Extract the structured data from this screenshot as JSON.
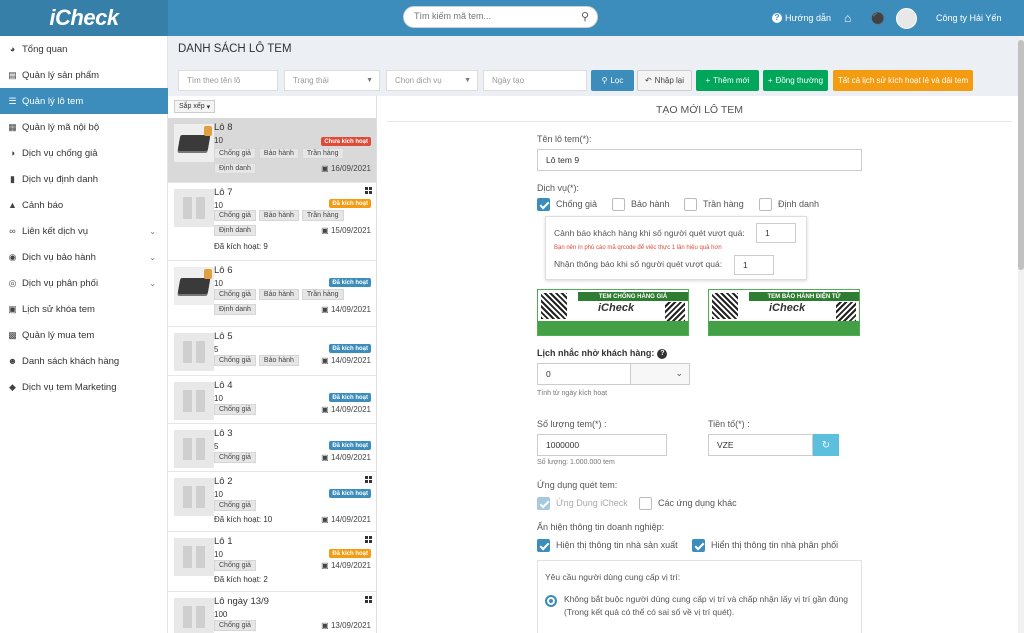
{
  "header": {
    "logo": "iCheck",
    "search_placeholder": "Tìm kiếm mã tem...",
    "guide_label": "Hướng dẫn",
    "company": "Công ty Hải Yến"
  },
  "sidebar": {
    "items": [
      {
        "label": "Tổng quan",
        "icon": "dashboard-icon"
      },
      {
        "label": "Quản lý sản phẩm",
        "icon": "product-icon"
      },
      {
        "label": "Quản lý lô tem",
        "icon": "list-icon"
      },
      {
        "label": "Quản lý mã nội bộ",
        "icon": "book-icon"
      },
      {
        "label": "Dịch vụ chống giả",
        "icon": "shield-icon"
      },
      {
        "label": "Dịch vụ định danh",
        "icon": "id-icon"
      },
      {
        "label": "Cảnh báo",
        "icon": "bell-icon"
      },
      {
        "label": "Liên kết dịch vụ",
        "icon": "link-icon"
      },
      {
        "label": "Dịch vụ bảo hành",
        "icon": "lifebuoy-icon"
      },
      {
        "label": "Dịch vụ phân phối",
        "icon": "globe-icon"
      },
      {
        "label": "Lịch sử khóa tem",
        "icon": "lock-icon"
      },
      {
        "label": "Quản lý mua tem",
        "icon": "cart-icon"
      },
      {
        "label": "Danh sách khách hàng",
        "icon": "users-icon"
      },
      {
        "label": "Dịch vụ tem Marketing",
        "icon": "tag-icon"
      }
    ]
  },
  "page": {
    "title": "DANH SÁCH LÔ TEM"
  },
  "filters": {
    "name_placeholder": "Tìm theo tên lô",
    "status_placeholder": "Trạng thái",
    "service_placeholder": "Chọn dịch vụ",
    "date_placeholder": "Ngày tạo",
    "filter_label": "Lọc",
    "reset_label": "Nhập lại",
    "add_label": "Thêm mới",
    "sync_label": "Đồng thường",
    "history_label": "Tất cả lịch sử kích hoạt lẻ và dải tem"
  },
  "list": {
    "sort_label": "Sắp xếp",
    "lots": [
      {
        "name": "Lô 8",
        "qty": "10",
        "badge": "Chưa kích hoạt",
        "chips": [
          "Chống giả",
          "Bảo hành",
          "Trần hàng",
          "Định danh"
        ],
        "date": "16/09/2021",
        "extra": ""
      },
      {
        "name": "Lô 7",
        "qty": "10",
        "badge": "Đã kích hoạt",
        "chips": [
          "Chống giả",
          "Bảo hành",
          "Trần hàng",
          "Định danh"
        ],
        "date": "15/09/2021",
        "extra": "Đã kích hoạt: 9"
      },
      {
        "name": "Lô 6",
        "qty": "10",
        "badge": "Đã kích hoạt",
        "chips": [
          "Chống giả",
          "Bảo hành",
          "Trần hàng",
          "Định danh"
        ],
        "date": "14/09/2021",
        "extra": ""
      },
      {
        "name": "Lô 5",
        "qty": "5",
        "badge": "Đã kích hoạt",
        "chips": [
          "Chống giả",
          "Bảo hành"
        ],
        "date": "14/09/2021",
        "extra": ""
      },
      {
        "name": "Lô 4",
        "qty": "10",
        "badge": "Đã kích hoạt",
        "chips": [
          "Chống giả"
        ],
        "date": "14/09/2021",
        "extra": ""
      },
      {
        "name": "Lô 3",
        "qty": "5",
        "badge": "Đã kích hoạt",
        "chips": [
          "Chống giả"
        ],
        "date": "14/09/2021",
        "extra": ""
      },
      {
        "name": "Lô 2",
        "qty": "10",
        "badge": "Đã kích hoạt",
        "chips": [
          "Chống giả"
        ],
        "date": "14/09/2021",
        "extra": "Đã kích hoạt: 10"
      },
      {
        "name": "Lô 1",
        "qty": "10",
        "badge": "Đã kích hoạt",
        "chips": [
          "Chống giả"
        ],
        "date": "14/09/2021",
        "extra": "Đã kích hoạt: 2"
      },
      {
        "name": "Lô ngày 13/9",
        "qty": "100",
        "badge": "",
        "chips": [
          "Chống giả"
        ],
        "date": "13/09/2021",
        "extra": ""
      }
    ]
  },
  "form": {
    "title": "TẠO MỚI LÔ TEM",
    "lot_name_label": "Tên lô tem(*):",
    "lot_name_value": "Lô tem 9",
    "service_label": "Dịch vụ(*):",
    "services": [
      "Chống giả",
      "Bảo hành",
      "Trần hàng",
      "Định danh"
    ],
    "warn_label": "Cảnh báo khách hàng khi số người quét vượt quá:",
    "warn_value": "1",
    "warn_hint": "Bạn nên in phủ cào mã qrcode để việc thực 1 lần hiệu quả hơn",
    "notify_label": "Nhận thông báo khi số người quét vượt quá:",
    "notify_value": "1",
    "stamp1_title": "TEM CHỐNG HÀNG GIẢ",
    "stamp2_title": "TEM BẢO HÀNH ĐIỆN TỬ",
    "stamp_brand": "iCheck",
    "reminder_label": "Lịch nhắc nhở khách hàng:",
    "reminder_value": "0",
    "reminder_hint": "Tính từ ngày kích hoạt",
    "qty_label": "Số lượng tem(*) :",
    "qty_value": "1000000",
    "qty_hint": "Số lượng: 1.000.000 tem",
    "prefix_label": "Tiền tố(*) :",
    "prefix_value": "VZE",
    "scan_app_label": "Ứng dụng quét tem:",
    "app_icheck": "Ứng Dụng iCheck",
    "app_other": "Các ứng dụng khác",
    "display_label": "Ẩn hiện thông tin doanh nghiệp:",
    "show_maker": "Hiện thị thông tin nhà sản xuất",
    "show_dist": "Hiển thị thông tin nhà phân phối",
    "location_label": "Yêu cầu người dùng cung cấp vị trí:",
    "location_opt1": "Không bắt buộc người dùng cung cấp vị trí và chấp nhận lấy vị trí gần đúng (Trong kết quả có thể có sai số về vị trí quét)."
  },
  "colors": {
    "primary": "#3c8dbc",
    "primary_dark": "#367fa9",
    "green": "#00a65a",
    "orange": "#f39c12",
    "red": "#dd4b39"
  }
}
